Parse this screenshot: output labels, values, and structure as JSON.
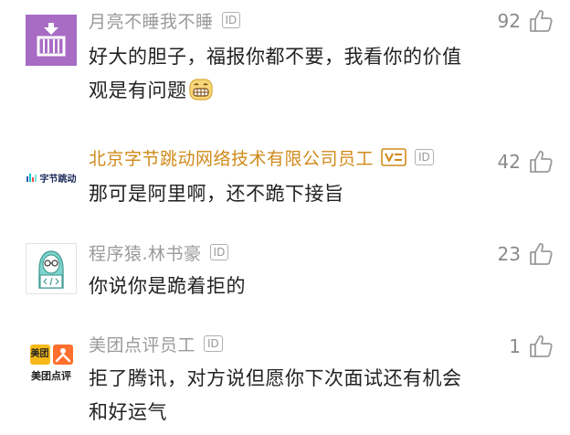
{
  "comments": [
    {
      "username": "月亮不睡我不睡",
      "id_badge": "ID",
      "likes": "92",
      "content_line1": "好大的胆子，福报你都不要，我看你的价值",
      "content_line2": "观是有问题",
      "avatar_icon": "anchor-crate-icon",
      "emoji_icon": "grinning-face-icon"
    },
    {
      "username": "北京字节跳动网络技术有限公司员工",
      "id_badge": "ID",
      "likes": "42",
      "content_line1": "那可是阿里啊，还不跪下接旨",
      "avatar_text": "字节跳动",
      "avatar_icon": "bytedance-logo-icon",
      "verified_icon": "verified-v-icon"
    },
    {
      "username": "程序猿.林书豪",
      "id_badge": "ID",
      "likes": "23",
      "content_line1": "你说你是跪着拒的",
      "avatar_icon": "programmer-avatar-icon"
    },
    {
      "username": "美团点评员工",
      "id_badge": "ID",
      "likes": "1",
      "content_line1": "拒了腾讯，对方说但愿你下次面试还有机会",
      "content_line2": "和好运气",
      "avatar_text_top": "美团",
      "avatar_text_bottom": "美团点评",
      "avatar_icon": "meituan-logo-icon"
    }
  ],
  "colors": {
    "username": "#9a9a9a",
    "verified_username": "#d08a1a",
    "content": "#222222",
    "like": "#8a8a8a",
    "purple_avatar": "#a86cc4",
    "meituan_yellow": "#f6b91a",
    "meituan_orange": "#ff6f2e",
    "teal_avatar": "#7fd4cf"
  }
}
